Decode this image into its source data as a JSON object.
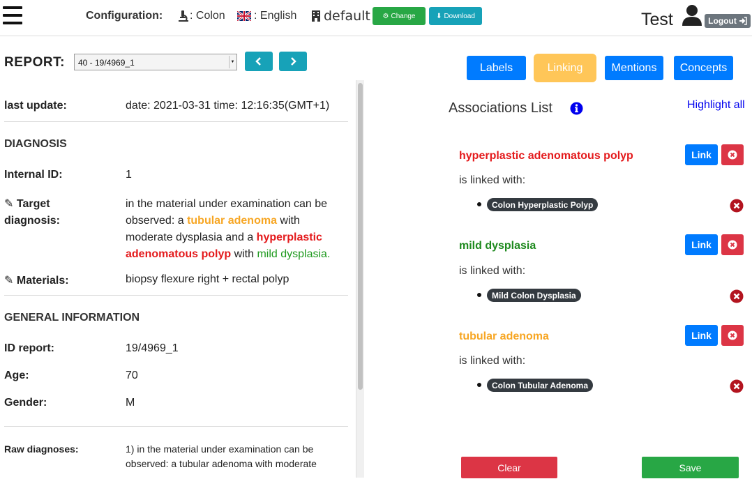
{
  "header": {
    "config_label": "Configuration:",
    "usecase": ": Colon",
    "language": ": English",
    "institute": "default",
    "change_label": "Change",
    "download_label": "Download",
    "username": "Test",
    "logout_label": "Logout"
  },
  "report": {
    "label": "REPORT:",
    "selected": "40 - 19/4969_1"
  },
  "tabs": [
    {
      "label": "Labels"
    },
    {
      "label": "Linking"
    },
    {
      "label": "Mentions"
    },
    {
      "label": "Concepts"
    }
  ],
  "details": {
    "last_update_label": "last update:",
    "last_update_value": "date: 2021-03-31 time: 12:16:35(GMT+1)",
    "diagnosis_section": "DIAGNOSIS",
    "internal_id_label": "Internal ID:",
    "internal_id_value": "1",
    "target_label_line1": "Target",
    "target_label_line2": "diagnosis:",
    "target_text": {
      "p1": "in the material under examination can be observed: a ",
      "m1": "tubular adenoma",
      "p2": " with moderate dysplasia and a ",
      "m2": "hyperplastic adenomatous polyp",
      "p3": " with ",
      "m3": "mild dysplasia."
    },
    "materials_label": "Materials:",
    "materials_value": "biopsy flexure right + rectal polyp",
    "general_section": "GENERAL INFORMATION",
    "id_report_label": "ID report:",
    "id_report_value": "19/4969_1",
    "age_label": "Age:",
    "age_value": "70",
    "gender_label": "Gender:",
    "gender_value": "M",
    "raw_label": "Raw diagnoses:",
    "raw_value": "1) in the material under examination can be observed: a tubular adenoma with moderate"
  },
  "associations": {
    "title": "Associations List",
    "highlight_all": "Highlight all",
    "linked_with_label": "is linked with:",
    "link_label": "Link",
    "items": [
      {
        "mention": "hyperplastic adenomatous polyp",
        "color": "#e41a1c",
        "concept": "Colon Hyperplastic Polyp"
      },
      {
        "mention": "mild dysplasia",
        "color": "#1e8a1e",
        "concept": "Mild Colon Dysplasia"
      },
      {
        "mention": "tubular adenoma",
        "color": "#f7a623",
        "concept": "Colon Tubular Adenoma"
      }
    ]
  },
  "footer": {
    "clear_label": "Clear",
    "save_label": "Save"
  }
}
